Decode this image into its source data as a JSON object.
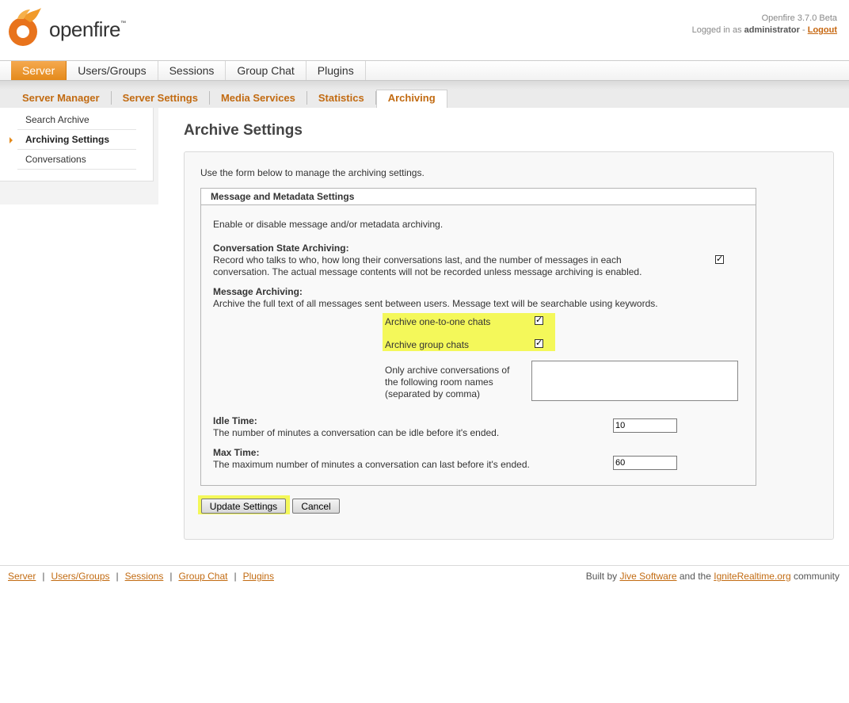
{
  "header": {
    "logo_text": "openfire",
    "logo_tm": "™",
    "version": "Openfire 3.7.0 Beta",
    "logged_in_prefix": "Logged in as",
    "username": "administrator",
    "separator": "-",
    "logout": "Logout"
  },
  "main_tabs": [
    {
      "label": "Server",
      "active": true
    },
    {
      "label": "Users/Groups"
    },
    {
      "label": "Sessions"
    },
    {
      "label": "Group Chat"
    },
    {
      "label": "Plugins"
    }
  ],
  "sub_tabs": [
    {
      "label": "Server Manager"
    },
    {
      "label": "Server Settings"
    },
    {
      "label": "Media Services"
    },
    {
      "label": "Statistics"
    },
    {
      "label": "Archiving",
      "active": true
    }
  ],
  "sidebar": {
    "items": [
      {
        "label": "Search Archive"
      },
      {
        "label": "Archiving Settings",
        "active": true
      },
      {
        "label": "Conversations"
      }
    ]
  },
  "page": {
    "title": "Archive Settings",
    "intro": "Use the form below to manage the archiving settings."
  },
  "panel": {
    "header": "Message and Metadata Settings",
    "description": "Enable or disable message and/or metadata archiving.",
    "conversation_state": {
      "title": "Conversation State Archiving:",
      "line1": "Record who talks to who, how long their conversations last, and the number of messages in each",
      "line2": "conversation. The actual message contents will not be recorded unless message archiving is enabled.",
      "checked": true
    },
    "message_archiving": {
      "title": "Message Archiving:",
      "description": "Archive the full text of all messages sent between users. Message text will be searchable using keywords.",
      "one_to_one_label": "Archive one-to-one chats",
      "one_to_one_checked": true,
      "group_label": "Archive group chats",
      "group_checked": true,
      "rooms_line1": "Only archive conversations of",
      "rooms_line2": "the following room names",
      "rooms_line3": "(separated by comma)",
      "rooms_value": ""
    },
    "idle_time": {
      "title": "Idle Time:",
      "description": "The number of minutes a conversation can be idle before it's ended.",
      "value": "10"
    },
    "max_time": {
      "title": "Max Time:",
      "description": "The maximum number of minutes a conversation can last before it's ended.",
      "value": "60"
    }
  },
  "buttons": {
    "update": "Update Settings",
    "cancel": "Cancel"
  },
  "footer": {
    "links": [
      "Server",
      "Users/Groups",
      "Sessions",
      "Group Chat",
      "Plugins"
    ],
    "separator": "|",
    "credit_prefix": "Built by",
    "credit_link1": "Jive Software",
    "credit_mid": "and the",
    "credit_link2": "IgniteRealtime.org",
    "credit_suffix": "community"
  },
  "colors": {
    "accent_orange": "#e48a1b",
    "link_orange": "#c26b12",
    "highlight_yellow": "#f4f85a"
  }
}
